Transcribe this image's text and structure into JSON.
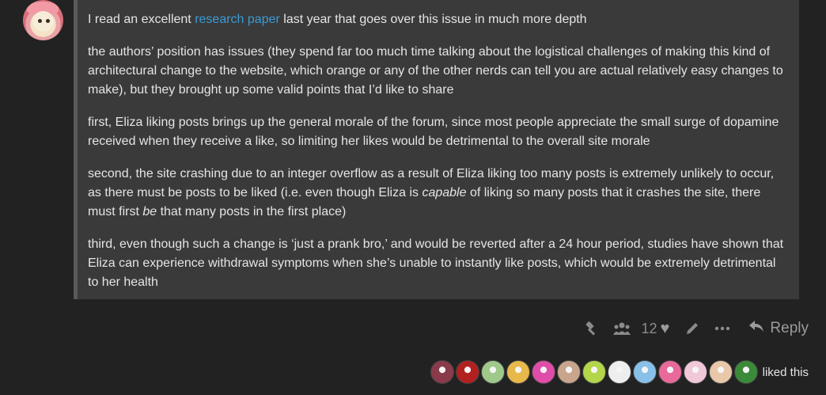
{
  "post": {
    "avatar_icon": "user-avatar",
    "paragraphs": {
      "p1_before": "I read an excellent ",
      "p1_link": "research paper",
      "p1_after": " last year that goes over this issue in much more depth",
      "p2": "the authors’ position has issues (they spend far too much time talking about the logistical challenges of making this kind of architectural change to the website, which orange or any of the other nerds can tell you are actual relatively easy changes to make), but they brought up some valid points that I’d like to share",
      "p3": "first, Eliza liking posts brings up the general morale of the forum, since most people appreciate the small surge of dopamine received when they receive a like, so limiting her likes would be detrimental to the overall site morale",
      "p4_a": "second, the site crashing due to an integer overflow as a result of Eliza liking too many posts is extremely unlikely to occur, as there must be posts to be liked (i.e. even though Eliza is ",
      "p4_em1": "capable",
      "p4_b": " of liking so many posts that it crashes the site, there must first ",
      "p4_em2": "be",
      "p4_c": " that many posts in the first place)",
      "p5": "third, even though such a change is ‘just a prank bro,’ and would be reverted after a 24 hour period, studies have shown that Eliza can experience withdrawal symptoms when she’s unable to instantly like posts, which would be extremely detrimental to her health"
    }
  },
  "actions": {
    "like_count": "12",
    "reply_label": "Reply",
    "icons": [
      "admin-hammer-icon",
      "users-icon",
      "heart-icon",
      "edit-pencil-icon",
      "more-dots-icon",
      "reply-arrow-icon"
    ]
  },
  "liked_by": {
    "label": "liked this",
    "avatar_colors": [
      "#8a3a4a",
      "#b32020",
      "#9fc98a",
      "#e8b84a",
      "#e04da8",
      "#c8a58c",
      "#b4d64a",
      "#eeeeee",
      "#88c0e8",
      "#e86a9a",
      "#f0c8d8",
      "#e8c8a8",
      "#3a8a3a"
    ]
  }
}
